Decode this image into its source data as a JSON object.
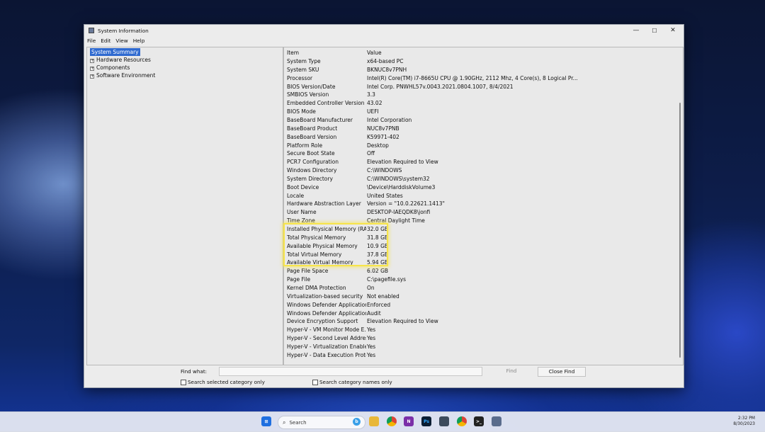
{
  "window": {
    "title": "System Information",
    "menu": [
      "File",
      "Edit",
      "View",
      "Help"
    ],
    "controls": {
      "minimize": "—",
      "maximize": "☐",
      "close": "✕"
    }
  },
  "tree": {
    "selected": "System Summary",
    "children": [
      "Hardware Resources",
      "Components",
      "Software Environment"
    ]
  },
  "table": {
    "header": {
      "item": "Item",
      "value": "Value"
    },
    "rows": [
      [
        "System Type",
        "x64-based PC"
      ],
      [
        "System SKU",
        "BKNUC8v7PNH"
      ],
      [
        "Processor",
        "Intel(R) Core(TM) i7-8665U CPU @ 1.90GHz, 2112 Mhz, 4 Core(s), 8 Logical Pr..."
      ],
      [
        "BIOS Version/Date",
        "Intel Corp. PNWHL57v.0043.2021.0804.1007, 8/4/2021"
      ],
      [
        "SMBIOS Version",
        "3.3"
      ],
      [
        "Embedded Controller Version",
        "43.02"
      ],
      [
        "BIOS Mode",
        "UEFI"
      ],
      [
        "BaseBoard Manufacturer",
        "Intel Corporation"
      ],
      [
        "BaseBoard Product",
        "NUC8v7PNB"
      ],
      [
        "BaseBoard Version",
        "K59971-402"
      ],
      [
        "Platform Role",
        "Desktop"
      ],
      [
        "Secure Boot State",
        "Off"
      ],
      [
        "PCR7 Configuration",
        "Elevation Required to View"
      ],
      [
        "Windows Directory",
        "C:\\WINDOWS"
      ],
      [
        "System Directory",
        "C:\\WINDOWS\\system32"
      ],
      [
        "Boot Device",
        "\\Device\\HarddiskVolume3"
      ],
      [
        "Locale",
        "United States"
      ],
      [
        "Hardware Abstraction Layer",
        "Version = \"10.0.22621.1413\""
      ],
      [
        "User Name",
        "DESKTOP-IAEQDK8\\jonfi"
      ],
      [
        "Time Zone",
        "Central Daylight Time"
      ],
      [
        "Installed Physical Memory (RAM)",
        "32.0 GB"
      ],
      [
        "Total Physical Memory",
        "31.8 GB"
      ],
      [
        "Available Physical Memory",
        "10.9 GB"
      ],
      [
        "Total Virtual Memory",
        "37.8 GB"
      ],
      [
        "Available Virtual Memory",
        "5.94 GB"
      ],
      [
        "Page File Space",
        "6.02 GB"
      ],
      [
        "Page File",
        "C:\\pagefile.sys"
      ],
      [
        "Kernel DMA Protection",
        "On"
      ],
      [
        "Virtualization-based security",
        "Not enabled"
      ],
      [
        "Windows Defender Application...",
        "Enforced"
      ],
      [
        "Windows Defender Application...",
        "Audit"
      ],
      [
        "Device Encryption Support",
        "Elevation Required to View"
      ],
      [
        "Hyper-V - VM Monitor Mode E...",
        "Yes"
      ],
      [
        "Hyper-V - Second Level Addres...",
        "Yes"
      ],
      [
        "Hyper-V - Virtualization Enable...",
        "Yes"
      ],
      [
        "Hyper-V - Data Execution Prote...",
        "Yes"
      ]
    ]
  },
  "find": {
    "label": "Find what:",
    "value": "",
    "find_button": "Find",
    "close_button": "Close Find",
    "option1": "Search selected category only",
    "option2": "Search category names only"
  },
  "taskbar": {
    "search_label": "Search",
    "time": "2:32 PM",
    "date": "8/30/2023",
    "icons": [
      "windows-start-icon",
      "search-icon",
      "bing-icon",
      "file-explorer-icon",
      "chrome-icon",
      "onenote-icon",
      "photoshop-icon",
      "calculator-icon",
      "chrome-profile-icon",
      "terminal-icon",
      "system-information-icon"
    ]
  },
  "colors": {
    "selection": "#2f6ad0",
    "highlight": "#f6e44a"
  }
}
